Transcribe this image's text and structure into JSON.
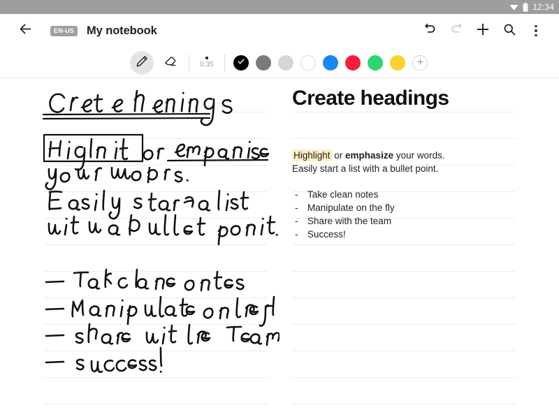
{
  "status_bar": {
    "wifi_icon": "wifi-icon",
    "battery_icon": "battery-icon",
    "time": "12:34"
  },
  "app_bar": {
    "back_icon": "back-arrow-icon",
    "language_badge": "EN-US",
    "title": "My notebook",
    "actions": [
      {
        "name": "undo-button",
        "icon": "undo-icon",
        "enabled": true
      },
      {
        "name": "redo-button",
        "icon": "redo-icon",
        "enabled": false
      },
      {
        "name": "add-button",
        "icon": "plus-icon",
        "enabled": true
      },
      {
        "name": "search-button",
        "icon": "search-icon",
        "enabled": true
      },
      {
        "name": "overflow-menu-button",
        "icon": "kebab-menu-icon",
        "enabled": true
      }
    ]
  },
  "tool_bar": {
    "pen_tool": {
      "label": "Pen",
      "icon": "pen-icon",
      "selected": true
    },
    "eraser_tool": {
      "label": "Eraser",
      "icon": "eraser-icon",
      "selected": false
    },
    "stroke_size": "0.35",
    "colors": [
      {
        "name": "black",
        "hex": "#000000",
        "selected": true
      },
      {
        "name": "gray",
        "hex": "#7a7a7a",
        "selected": false
      },
      {
        "name": "light-gray",
        "hex": "#d6d6d6",
        "selected": false
      },
      {
        "name": "white",
        "hex": "#ffffff",
        "selected": false
      },
      {
        "name": "blue",
        "hex": "#1a85f5",
        "selected": false
      },
      {
        "name": "red",
        "hex": "#fa1e3c",
        "selected": false
      },
      {
        "name": "green",
        "hex": "#2ed573",
        "selected": false
      },
      {
        "name": "yellow",
        "hex": "#fdd033",
        "selected": false
      }
    ],
    "add_color_label": "+"
  },
  "handwriting_page": {
    "heading": "Create headings",
    "line_boxed": "Highlight",
    "line_mid": "or emphasize",
    "line_2": "your words.",
    "line_3": "Easily start a list",
    "line_4": "with a bullet point.",
    "bullets": [
      "Take clean notes",
      "Manipulate on the fly",
      "Share with the team",
      "success!"
    ]
  },
  "typed_page": {
    "heading": "Create headings",
    "para_highlight": "Highlight",
    "para_mid": " or ",
    "para_bold": "emphasize",
    "para_tail": " your words.",
    "para_line2": "Easily start a list with a bullet point.",
    "bullet_marker": "-",
    "bullets": [
      "Take clean notes",
      "Manipulate on the fly",
      "Share with the team",
      "Success!"
    ]
  },
  "theme": {
    "status_bar_bg": "#9e9e9e",
    "rule_line": "#ededed",
    "highlight": "#fdf0c2",
    "badge_bg": "#9aa0a6"
  }
}
